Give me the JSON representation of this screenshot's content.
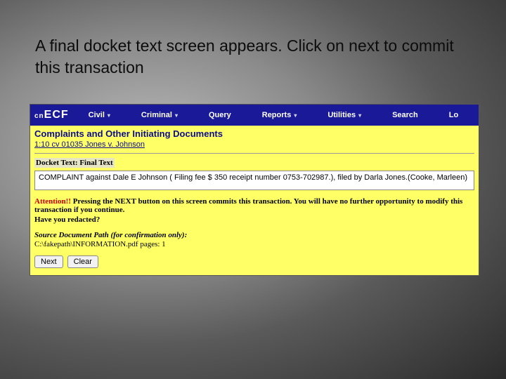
{
  "caption": "A final docket text screen appears. Click on next to commit this transaction",
  "logo": {
    "prefix": "cn",
    "main": "ECF"
  },
  "nav": {
    "civil": "Civil",
    "criminal": "Criminal",
    "query": "Query",
    "reports": "Reports",
    "utilities": "Utilities",
    "search": "Search",
    "logout": "Lo"
  },
  "page_title": "Complaints and Other Initiating Documents",
  "case_link": "1:10 cv 01035 Jones v. Johnson",
  "section_label": "Docket Text: Final Text",
  "docket_text": "COMPLAINT against Dale E Johnson ( Filing fee $ 350 receipt number 0753-702987.), filed by Darla Jones.(Cooke, Marleen)",
  "attention": {
    "prefix": "Attention!!",
    "body": " Pressing the NEXT button on this screen commits this transaction. You will have no further opportunity to modify this transaction if you continue."
  },
  "redacted": "Have you redacted?",
  "source_label": "Source Document Path (for confirmation only):",
  "source_path": "C:\\fakepath\\INFORMATION.pdf    pages: 1",
  "buttons": {
    "next": "Next",
    "clear": "Clear"
  }
}
